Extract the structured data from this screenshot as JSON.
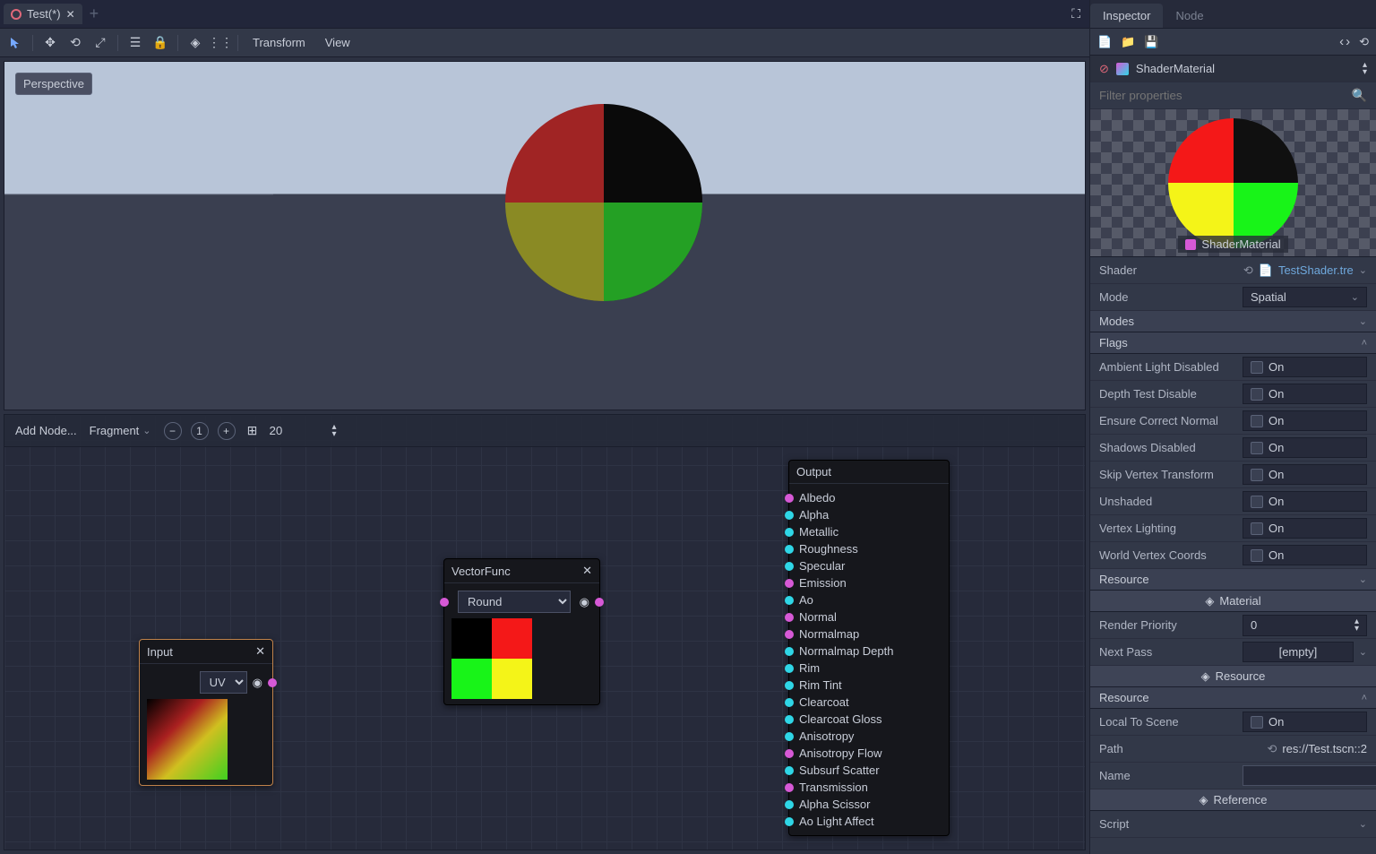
{
  "scene_tab": {
    "title": "Test(*)"
  },
  "toolbar": {
    "transform": "Transform",
    "view": "View"
  },
  "viewport": {
    "perspective": "Perspective"
  },
  "node_editor": {
    "add_node": "Add Node...",
    "stage": "Fragment",
    "zoom": "20",
    "nodes": {
      "input": {
        "title": "Input",
        "uv": "UV"
      },
      "vectorfunc": {
        "title": "VectorFunc",
        "op": "Round"
      },
      "output": {
        "title": "Output",
        "ports": [
          {
            "label": "Albedo",
            "color": "mag"
          },
          {
            "label": "Alpha",
            "color": "cyan"
          },
          {
            "label": "Metallic",
            "color": "cyan"
          },
          {
            "label": "Roughness",
            "color": "cyan"
          },
          {
            "label": "Specular",
            "color": "cyan"
          },
          {
            "label": "Emission",
            "color": "mag"
          },
          {
            "label": "Ao",
            "color": "cyan"
          },
          {
            "label": "Normal",
            "color": "mag"
          },
          {
            "label": "Normalmap",
            "color": "mag"
          },
          {
            "label": "Normalmap Depth",
            "color": "cyan"
          },
          {
            "label": "Rim",
            "color": "cyan"
          },
          {
            "label": "Rim Tint",
            "color": "cyan"
          },
          {
            "label": "Clearcoat",
            "color": "cyan"
          },
          {
            "label": "Clearcoat Gloss",
            "color": "cyan"
          },
          {
            "label": "Anisotropy",
            "color": "cyan"
          },
          {
            "label": "Anisotropy Flow",
            "color": "mag"
          },
          {
            "label": "Subsurf Scatter",
            "color": "cyan"
          },
          {
            "label": "Transmission",
            "color": "mag"
          },
          {
            "label": "Alpha Scissor",
            "color": "cyan"
          },
          {
            "label": "Ao Light Affect",
            "color": "cyan"
          }
        ]
      }
    }
  },
  "inspector": {
    "tabs": {
      "inspector": "Inspector",
      "node": "Node"
    },
    "type": "ShaderMaterial",
    "filter_placeholder": "Filter properties",
    "preview_label": "ShaderMaterial",
    "props": {
      "shader": {
        "label": "Shader",
        "value": "TestShader.tre"
      },
      "mode": {
        "label": "Mode",
        "value": "Spatial"
      },
      "modes_hdr": "Modes",
      "flags_hdr": "Flags",
      "flags": [
        {
          "label": "Ambient Light Disabled",
          "value": "On"
        },
        {
          "label": "Depth Test Disable",
          "value": "On"
        },
        {
          "label": "Ensure Correct Normal",
          "value": "On"
        },
        {
          "label": "Shadows Disabled",
          "value": "On"
        },
        {
          "label": "Skip Vertex Transform",
          "value": "On"
        },
        {
          "label": "Unshaded",
          "value": "On"
        },
        {
          "label": "Vertex Lighting",
          "value": "On"
        },
        {
          "label": "World Vertex Coords",
          "value": "On"
        }
      ],
      "resource_hdr": "Resource",
      "material_btn": "Material",
      "render_priority": {
        "label": "Render Priority",
        "value": "0"
      },
      "next_pass": {
        "label": "Next Pass",
        "value": "[empty]"
      },
      "resource_btn": "Resource",
      "resource_hdr2": "Resource",
      "local_to_scene": {
        "label": "Local To Scene",
        "value": "On"
      },
      "path": {
        "label": "Path",
        "value": "res://Test.tscn::2"
      },
      "name": {
        "label": "Name"
      },
      "reference_btn": "Reference",
      "script": {
        "label": "Script"
      }
    }
  }
}
